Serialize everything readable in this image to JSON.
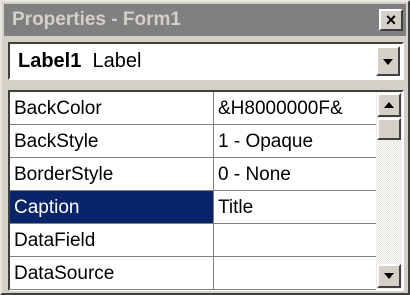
{
  "window": {
    "title": "Properties - Form1"
  },
  "object_selector": {
    "object_name": "Label1",
    "object_type": "Label"
  },
  "properties": [
    {
      "name": "BackColor",
      "value": "&H8000000F&"
    },
    {
      "name": "BackStyle",
      "value": "1 - Opaque"
    },
    {
      "name": "BorderStyle",
      "value": "0 - None"
    },
    {
      "name": "Caption",
      "value": "Title",
      "selected": true
    },
    {
      "name": "DataField",
      "value": ""
    },
    {
      "name": "DataSource",
      "value": ""
    }
  ],
  "icons": {
    "close": "close-icon",
    "dropdown": "chevron-down-icon",
    "scroll_up": "arrow-up-icon",
    "scroll_down": "arrow-down-icon"
  },
  "colors": {
    "titlebar_inactive": "#808080",
    "selection": "#0a246a",
    "face": "#d4d0c8"
  }
}
